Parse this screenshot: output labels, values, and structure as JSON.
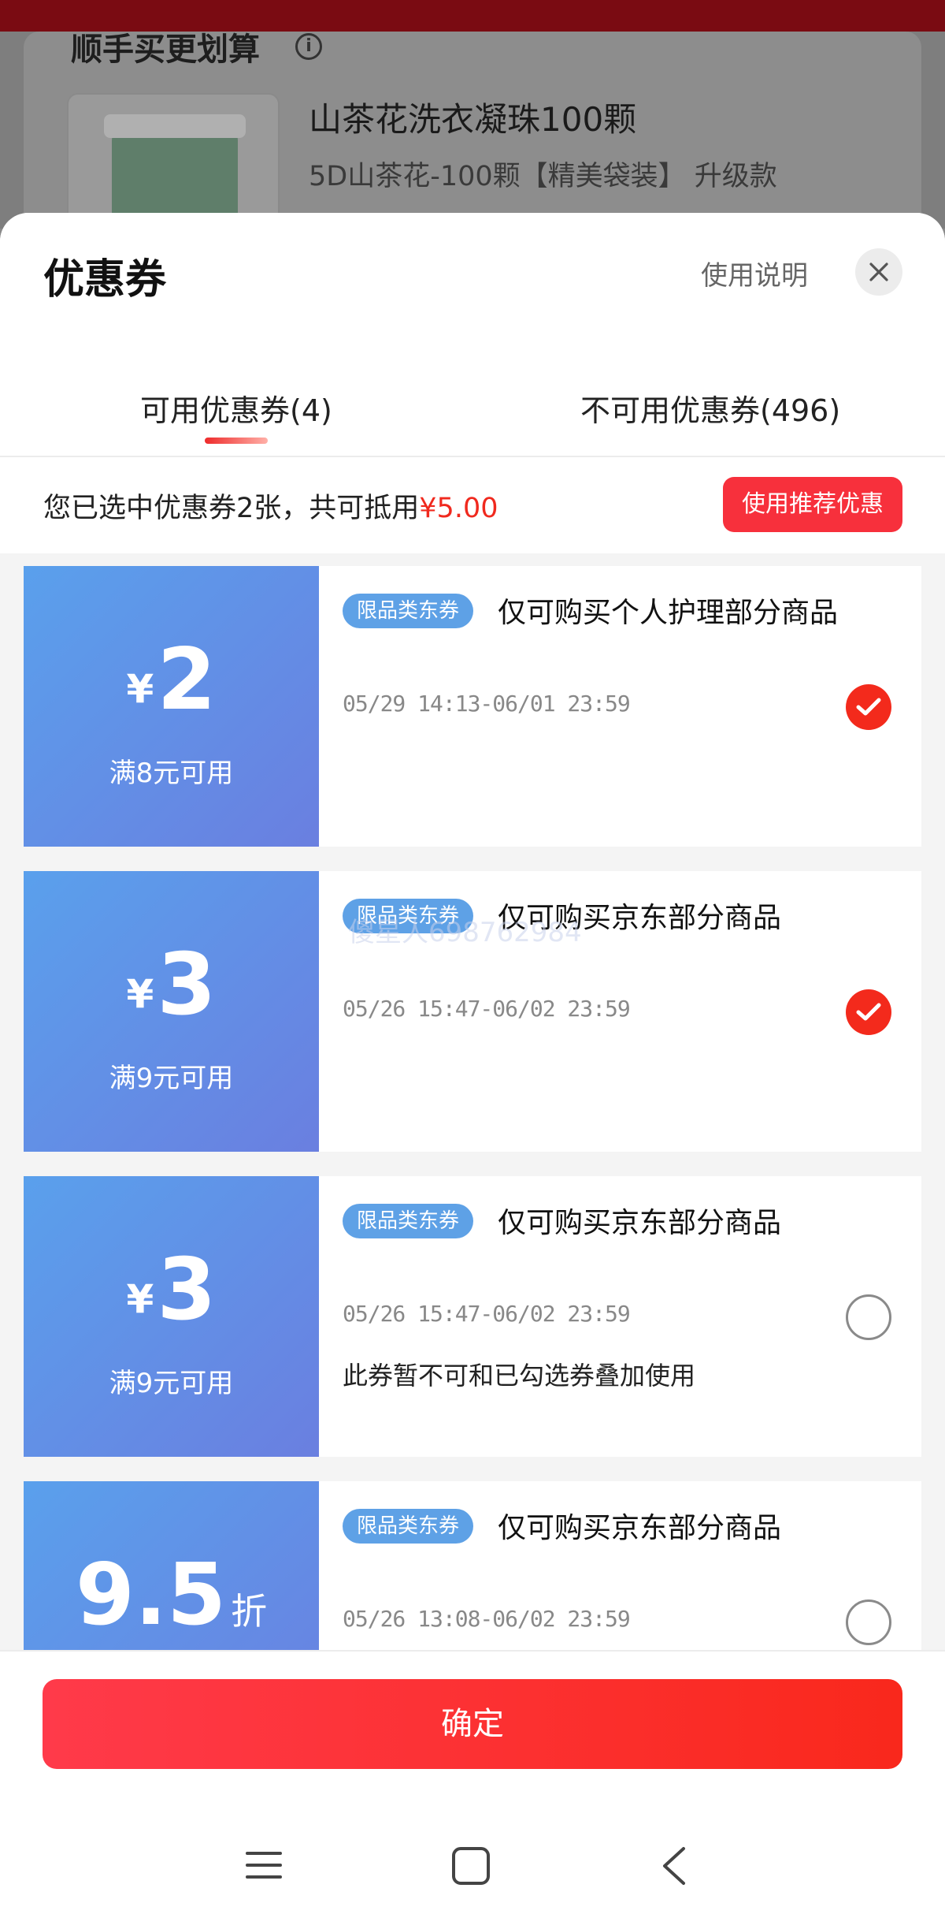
{
  "background": {
    "section_title": "顺手买更划算",
    "product_name": "山茶花洗衣凝珠100颗",
    "product_spec": "5D山茶花-100颗【精美袋装】  升级款"
  },
  "sheet": {
    "title": "优惠券",
    "usage_link": "使用说明",
    "close_icon": "close-icon"
  },
  "tabs": [
    {
      "label": "可用优惠券(4)",
      "active": true
    },
    {
      "label": "不可用优惠券(496)",
      "active": false
    }
  ],
  "summary": {
    "text": "您已选中优惠券2张，共可抵用",
    "amount": "¥5.00",
    "recommend_button": "使用推荐优惠"
  },
  "coupons": [
    {
      "currency": "¥",
      "amount": "2",
      "unit": "",
      "condition": "满8元可用",
      "tag": "限品类东券",
      "description": "仅可购买个人护理部分商品",
      "validity": "05/29 14:13-06/01 23:59",
      "note": "",
      "selected": true
    },
    {
      "currency": "¥",
      "amount": "3",
      "unit": "",
      "condition": "满9元可用",
      "tag": "限品类东券",
      "description": "仅可购买京东部分商品",
      "validity": "05/26 15:47-06/02 23:59",
      "note": "",
      "selected": true
    },
    {
      "currency": "¥",
      "amount": "3",
      "unit": "",
      "condition": "满9元可用",
      "tag": "限品类东券",
      "description": "仅可购买京东部分商品",
      "validity": "05/26 15:47-06/02 23:59",
      "note": "此券暂不可和已勾选券叠加使用",
      "selected": false
    },
    {
      "currency": "",
      "amount": "9.5",
      "unit": "折",
      "condition": "",
      "tag": "限品类东券",
      "description": "仅可购买京东部分商品",
      "validity": "05/26 13:08-06/02 23:59",
      "note": "",
      "selected": false
    }
  ],
  "watermark": "傻星人698762984",
  "footer": {
    "confirm_button": "确定"
  },
  "nav_bar": {
    "icons": [
      "menu-icon",
      "home-icon",
      "back-icon"
    ]
  },
  "colors": {
    "accent_red": "#f32a1c",
    "coupon_blue": "#5aa0ec",
    "tag_blue": "#5ea1e6"
  }
}
